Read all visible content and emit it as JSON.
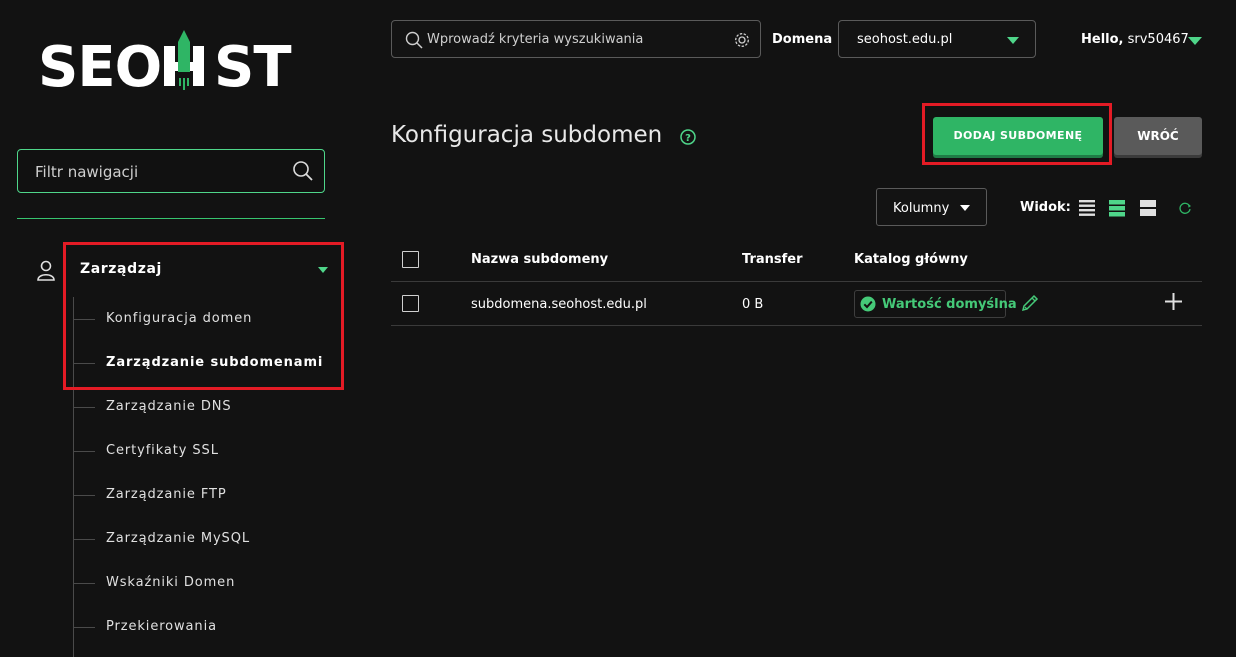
{
  "brand": {
    "logo_text": "SEOHOST",
    "accent": "#2fb565",
    "highlight": "#e41b25"
  },
  "sidebar": {
    "filter_placeholder": "Filtr nawigacji",
    "group_label": "Zarządzaj",
    "items": [
      {
        "label": "Konfiguracja domen",
        "active": false
      },
      {
        "label": "Zarządzanie subdomenami",
        "active": true
      },
      {
        "label": "Zarządzanie DNS",
        "active": false
      },
      {
        "label": "Certyfikaty SSL",
        "active": false
      },
      {
        "label": "Zarządzanie FTP",
        "active": false
      },
      {
        "label": "Zarządzanie MySQL",
        "active": false
      },
      {
        "label": "Wskaźniki Domen",
        "active": false
      },
      {
        "label": "Przekierowania",
        "active": false
      }
    ]
  },
  "topbar": {
    "search_placeholder": "Wprowadź kryteria wyszukiwania",
    "domain_label": "Domena",
    "domain_value": "seohost.edu.pl",
    "hello_prefix": "Hello,",
    "user": "srv50467"
  },
  "page": {
    "title": "Konfiguracja subdomen",
    "add_button": "DODAJ SUBDOMENĘ",
    "back_button": "WRÓĆ",
    "columns_button": "Kolumny",
    "view_label": "Widok:"
  },
  "table": {
    "headers": [
      "Nazwa subdomeny",
      "Transfer",
      "Katalog główny"
    ],
    "rows": [
      {
        "name": "subdomena.seohost.edu.pl",
        "transfer": "0 B",
        "catalog": "Wartość domyślna"
      }
    ]
  }
}
